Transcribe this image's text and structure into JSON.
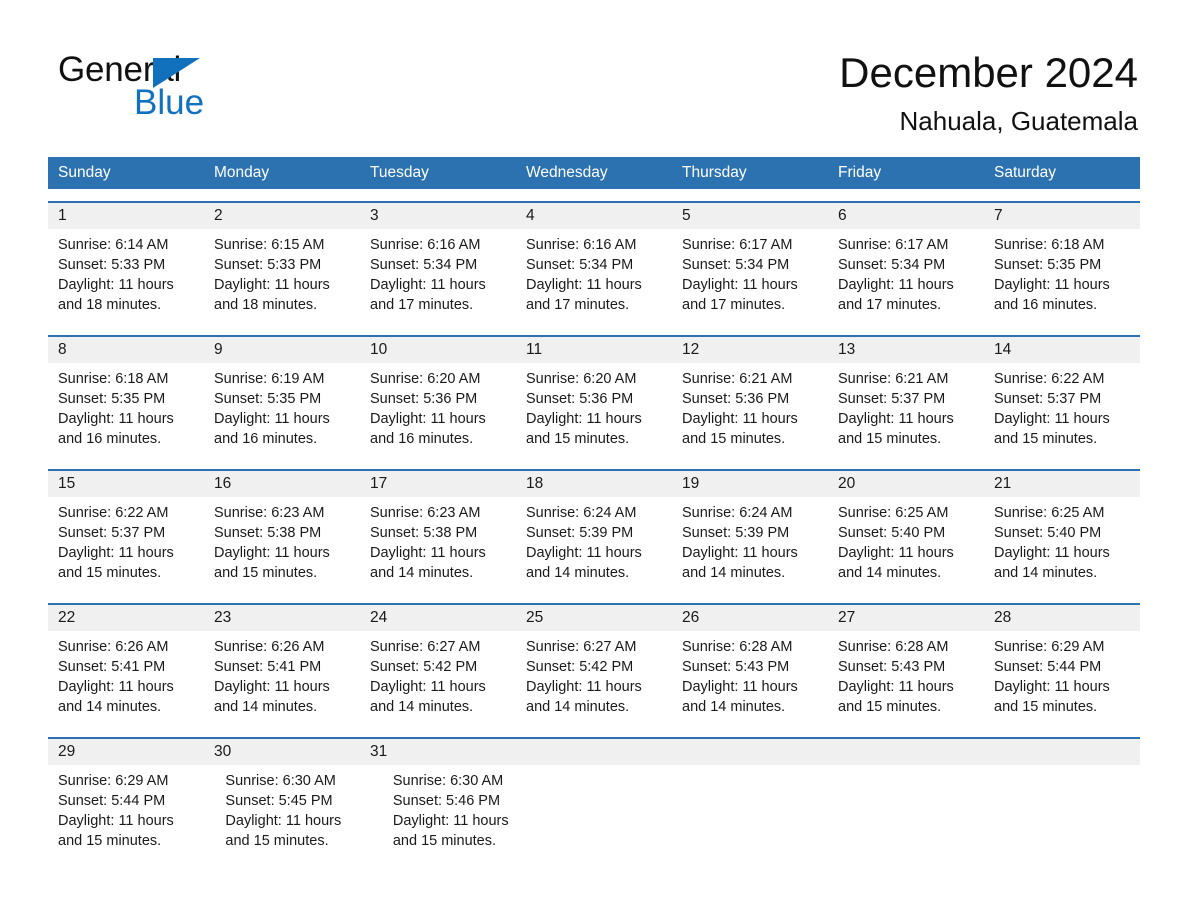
{
  "brand": {
    "name_part1": "General",
    "name_part2": "Blue",
    "accent_color": "#1271bd"
  },
  "header": {
    "title": "December 2024",
    "location": "Nahuala, Guatemala"
  },
  "theme": {
    "header_blue": "#2c72b0",
    "daynum_band_gray": "#f0f0f0",
    "divider_blue": "#2c72b0",
    "text_color": "#1a1a1a"
  },
  "weekdays": [
    "Sunday",
    "Monday",
    "Tuesday",
    "Wednesday",
    "Thursday",
    "Friday",
    "Saturday"
  ],
  "weeks": [
    {
      "days": [
        {
          "num": "1",
          "sunrise": "Sunrise: 6:14 AM",
          "sunset": "Sunset: 5:33 PM",
          "daylight_line1": "Daylight: 11 hours",
          "daylight_line2": "and 18 minutes."
        },
        {
          "num": "2",
          "sunrise": "Sunrise: 6:15 AM",
          "sunset": "Sunset: 5:33 PM",
          "daylight_line1": "Daylight: 11 hours",
          "daylight_line2": "and 18 minutes."
        },
        {
          "num": "3",
          "sunrise": "Sunrise: 6:16 AM",
          "sunset": "Sunset: 5:34 PM",
          "daylight_line1": "Daylight: 11 hours",
          "daylight_line2": "and 17 minutes."
        },
        {
          "num": "4",
          "sunrise": "Sunrise: 6:16 AM",
          "sunset": "Sunset: 5:34 PM",
          "daylight_line1": "Daylight: 11 hours",
          "daylight_line2": "and 17 minutes."
        },
        {
          "num": "5",
          "sunrise": "Sunrise: 6:17 AM",
          "sunset": "Sunset: 5:34 PM",
          "daylight_line1": "Daylight: 11 hours",
          "daylight_line2": "and 17 minutes."
        },
        {
          "num": "6",
          "sunrise": "Sunrise: 6:17 AM",
          "sunset": "Sunset: 5:34 PM",
          "daylight_line1": "Daylight: 11 hours",
          "daylight_line2": "and 17 minutes."
        },
        {
          "num": "7",
          "sunrise": "Sunrise: 6:18 AM",
          "sunset": "Sunset: 5:35 PM",
          "daylight_line1": "Daylight: 11 hours",
          "daylight_line2": "and 16 minutes."
        }
      ]
    },
    {
      "days": [
        {
          "num": "8",
          "sunrise": "Sunrise: 6:18 AM",
          "sunset": "Sunset: 5:35 PM",
          "daylight_line1": "Daylight: 11 hours",
          "daylight_line2": "and 16 minutes."
        },
        {
          "num": "9",
          "sunrise": "Sunrise: 6:19 AM",
          "sunset": "Sunset: 5:35 PM",
          "daylight_line1": "Daylight: 11 hours",
          "daylight_line2": "and 16 minutes."
        },
        {
          "num": "10",
          "sunrise": "Sunrise: 6:20 AM",
          "sunset": "Sunset: 5:36 PM",
          "daylight_line1": "Daylight: 11 hours",
          "daylight_line2": "and 16 minutes."
        },
        {
          "num": "11",
          "sunrise": "Sunrise: 6:20 AM",
          "sunset": "Sunset: 5:36 PM",
          "daylight_line1": "Daylight: 11 hours",
          "daylight_line2": "and 15 minutes."
        },
        {
          "num": "12",
          "sunrise": "Sunrise: 6:21 AM",
          "sunset": "Sunset: 5:36 PM",
          "daylight_line1": "Daylight: 11 hours",
          "daylight_line2": "and 15 minutes."
        },
        {
          "num": "13",
          "sunrise": "Sunrise: 6:21 AM",
          "sunset": "Sunset: 5:37 PM",
          "daylight_line1": "Daylight: 11 hours",
          "daylight_line2": "and 15 minutes."
        },
        {
          "num": "14",
          "sunrise": "Sunrise: 6:22 AM",
          "sunset": "Sunset: 5:37 PM",
          "daylight_line1": "Daylight: 11 hours",
          "daylight_line2": "and 15 minutes."
        }
      ]
    },
    {
      "days": [
        {
          "num": "15",
          "sunrise": "Sunrise: 6:22 AM",
          "sunset": "Sunset: 5:37 PM",
          "daylight_line1": "Daylight: 11 hours",
          "daylight_line2": "and 15 minutes."
        },
        {
          "num": "16",
          "sunrise": "Sunrise: 6:23 AM",
          "sunset": "Sunset: 5:38 PM",
          "daylight_line1": "Daylight: 11 hours",
          "daylight_line2": "and 15 minutes."
        },
        {
          "num": "17",
          "sunrise": "Sunrise: 6:23 AM",
          "sunset": "Sunset: 5:38 PM",
          "daylight_line1": "Daylight: 11 hours",
          "daylight_line2": "and 14 minutes."
        },
        {
          "num": "18",
          "sunrise": "Sunrise: 6:24 AM",
          "sunset": "Sunset: 5:39 PM",
          "daylight_line1": "Daylight: 11 hours",
          "daylight_line2": "and 14 minutes."
        },
        {
          "num": "19",
          "sunrise": "Sunrise: 6:24 AM",
          "sunset": "Sunset: 5:39 PM",
          "daylight_line1": "Daylight: 11 hours",
          "daylight_line2": "and 14 minutes."
        },
        {
          "num": "20",
          "sunrise": "Sunrise: 6:25 AM",
          "sunset": "Sunset: 5:40 PM",
          "daylight_line1": "Daylight: 11 hours",
          "daylight_line2": "and 14 minutes."
        },
        {
          "num": "21",
          "sunrise": "Sunrise: 6:25 AM",
          "sunset": "Sunset: 5:40 PM",
          "daylight_line1": "Daylight: 11 hours",
          "daylight_line2": "and 14 minutes."
        }
      ]
    },
    {
      "days": [
        {
          "num": "22",
          "sunrise": "Sunrise: 6:26 AM",
          "sunset": "Sunset: 5:41 PM",
          "daylight_line1": "Daylight: 11 hours",
          "daylight_line2": "and 14 minutes."
        },
        {
          "num": "23",
          "sunrise": "Sunrise: 6:26 AM",
          "sunset": "Sunset: 5:41 PM",
          "daylight_line1": "Daylight: 11 hours",
          "daylight_line2": "and 14 minutes."
        },
        {
          "num": "24",
          "sunrise": "Sunrise: 6:27 AM",
          "sunset": "Sunset: 5:42 PM",
          "daylight_line1": "Daylight: 11 hours",
          "daylight_line2": "and 14 minutes."
        },
        {
          "num": "25",
          "sunrise": "Sunrise: 6:27 AM",
          "sunset": "Sunset: 5:42 PM",
          "daylight_line1": "Daylight: 11 hours",
          "daylight_line2": "and 14 minutes."
        },
        {
          "num": "26",
          "sunrise": "Sunrise: 6:28 AM",
          "sunset": "Sunset: 5:43 PM",
          "daylight_line1": "Daylight: 11 hours",
          "daylight_line2": "and 14 minutes."
        },
        {
          "num": "27",
          "sunrise": "Sunrise: 6:28 AM",
          "sunset": "Sunset: 5:43 PM",
          "daylight_line1": "Daylight: 11 hours",
          "daylight_line2": "and 15 minutes."
        },
        {
          "num": "28",
          "sunrise": "Sunrise: 6:29 AM",
          "sunset": "Sunset: 5:44 PM",
          "daylight_line1": "Daylight: 11 hours",
          "daylight_line2": "and 15 minutes."
        }
      ]
    },
    {
      "days": [
        {
          "num": "29",
          "sunrise": "Sunrise: 6:29 AM",
          "sunset": "Sunset: 5:44 PM",
          "daylight_line1": "Daylight: 11 hours",
          "daylight_line2": "and 15 minutes."
        },
        {
          "num": "30",
          "sunrise": "Sunrise: 6:30 AM",
          "sunset": "Sunset: 5:45 PM",
          "daylight_line1": "Daylight: 11 hours",
          "daylight_line2": "and 15 minutes."
        },
        {
          "num": "31",
          "sunrise": "Sunrise: 6:30 AM",
          "sunset": "Sunset: 5:46 PM",
          "daylight_line1": "Daylight: 11 hours",
          "daylight_line2": "and 15 minutes."
        },
        {
          "num": "",
          "sunrise": "",
          "sunset": "",
          "daylight_line1": "",
          "daylight_line2": ""
        },
        {
          "num": "",
          "sunrise": "",
          "sunset": "",
          "daylight_line1": "",
          "daylight_line2": ""
        },
        {
          "num": "",
          "sunrise": "",
          "sunset": "",
          "daylight_line1": "",
          "daylight_line2": ""
        },
        {
          "num": "",
          "sunrise": "",
          "sunset": "",
          "daylight_line1": "",
          "daylight_line2": ""
        }
      ]
    }
  ]
}
